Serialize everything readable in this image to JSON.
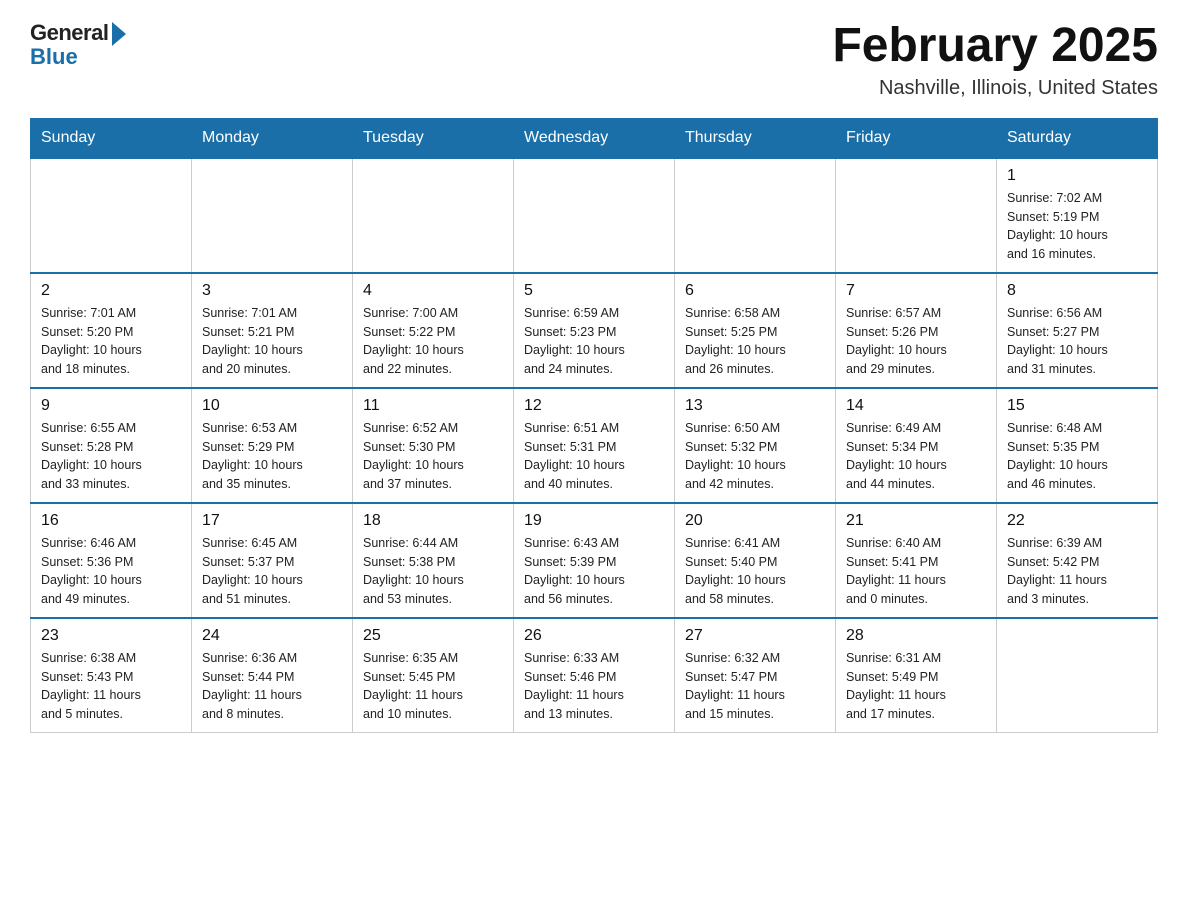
{
  "logo": {
    "general": "General",
    "blue": "Blue"
  },
  "title": {
    "month": "February 2025",
    "location": "Nashville, Illinois, United States"
  },
  "weekdays": [
    "Sunday",
    "Monday",
    "Tuesday",
    "Wednesday",
    "Thursday",
    "Friday",
    "Saturday"
  ],
  "weeks": [
    [
      {
        "day": "",
        "info": ""
      },
      {
        "day": "",
        "info": ""
      },
      {
        "day": "",
        "info": ""
      },
      {
        "day": "",
        "info": ""
      },
      {
        "day": "",
        "info": ""
      },
      {
        "day": "",
        "info": ""
      },
      {
        "day": "1",
        "info": "Sunrise: 7:02 AM\nSunset: 5:19 PM\nDaylight: 10 hours\nand 16 minutes."
      }
    ],
    [
      {
        "day": "2",
        "info": "Sunrise: 7:01 AM\nSunset: 5:20 PM\nDaylight: 10 hours\nand 18 minutes."
      },
      {
        "day": "3",
        "info": "Sunrise: 7:01 AM\nSunset: 5:21 PM\nDaylight: 10 hours\nand 20 minutes."
      },
      {
        "day": "4",
        "info": "Sunrise: 7:00 AM\nSunset: 5:22 PM\nDaylight: 10 hours\nand 22 minutes."
      },
      {
        "day": "5",
        "info": "Sunrise: 6:59 AM\nSunset: 5:23 PM\nDaylight: 10 hours\nand 24 minutes."
      },
      {
        "day": "6",
        "info": "Sunrise: 6:58 AM\nSunset: 5:25 PM\nDaylight: 10 hours\nand 26 minutes."
      },
      {
        "day": "7",
        "info": "Sunrise: 6:57 AM\nSunset: 5:26 PM\nDaylight: 10 hours\nand 29 minutes."
      },
      {
        "day": "8",
        "info": "Sunrise: 6:56 AM\nSunset: 5:27 PM\nDaylight: 10 hours\nand 31 minutes."
      }
    ],
    [
      {
        "day": "9",
        "info": "Sunrise: 6:55 AM\nSunset: 5:28 PM\nDaylight: 10 hours\nand 33 minutes."
      },
      {
        "day": "10",
        "info": "Sunrise: 6:53 AM\nSunset: 5:29 PM\nDaylight: 10 hours\nand 35 minutes."
      },
      {
        "day": "11",
        "info": "Sunrise: 6:52 AM\nSunset: 5:30 PM\nDaylight: 10 hours\nand 37 minutes."
      },
      {
        "day": "12",
        "info": "Sunrise: 6:51 AM\nSunset: 5:31 PM\nDaylight: 10 hours\nand 40 minutes."
      },
      {
        "day": "13",
        "info": "Sunrise: 6:50 AM\nSunset: 5:32 PM\nDaylight: 10 hours\nand 42 minutes."
      },
      {
        "day": "14",
        "info": "Sunrise: 6:49 AM\nSunset: 5:34 PM\nDaylight: 10 hours\nand 44 minutes."
      },
      {
        "day": "15",
        "info": "Sunrise: 6:48 AM\nSunset: 5:35 PM\nDaylight: 10 hours\nand 46 minutes."
      }
    ],
    [
      {
        "day": "16",
        "info": "Sunrise: 6:46 AM\nSunset: 5:36 PM\nDaylight: 10 hours\nand 49 minutes."
      },
      {
        "day": "17",
        "info": "Sunrise: 6:45 AM\nSunset: 5:37 PM\nDaylight: 10 hours\nand 51 minutes."
      },
      {
        "day": "18",
        "info": "Sunrise: 6:44 AM\nSunset: 5:38 PM\nDaylight: 10 hours\nand 53 minutes."
      },
      {
        "day": "19",
        "info": "Sunrise: 6:43 AM\nSunset: 5:39 PM\nDaylight: 10 hours\nand 56 minutes."
      },
      {
        "day": "20",
        "info": "Sunrise: 6:41 AM\nSunset: 5:40 PM\nDaylight: 10 hours\nand 58 minutes."
      },
      {
        "day": "21",
        "info": "Sunrise: 6:40 AM\nSunset: 5:41 PM\nDaylight: 11 hours\nand 0 minutes."
      },
      {
        "day": "22",
        "info": "Sunrise: 6:39 AM\nSunset: 5:42 PM\nDaylight: 11 hours\nand 3 minutes."
      }
    ],
    [
      {
        "day": "23",
        "info": "Sunrise: 6:38 AM\nSunset: 5:43 PM\nDaylight: 11 hours\nand 5 minutes."
      },
      {
        "day": "24",
        "info": "Sunrise: 6:36 AM\nSunset: 5:44 PM\nDaylight: 11 hours\nand 8 minutes."
      },
      {
        "day": "25",
        "info": "Sunrise: 6:35 AM\nSunset: 5:45 PM\nDaylight: 11 hours\nand 10 minutes."
      },
      {
        "day": "26",
        "info": "Sunrise: 6:33 AM\nSunset: 5:46 PM\nDaylight: 11 hours\nand 13 minutes."
      },
      {
        "day": "27",
        "info": "Sunrise: 6:32 AM\nSunset: 5:47 PM\nDaylight: 11 hours\nand 15 minutes."
      },
      {
        "day": "28",
        "info": "Sunrise: 6:31 AM\nSunset: 5:49 PM\nDaylight: 11 hours\nand 17 minutes."
      },
      {
        "day": "",
        "info": ""
      }
    ]
  ]
}
